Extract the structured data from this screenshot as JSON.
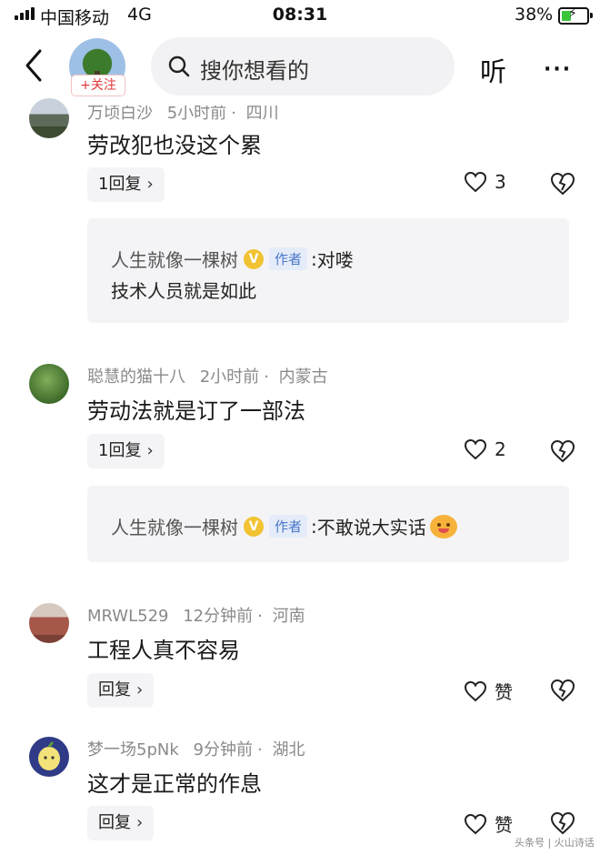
{
  "status_bar": {
    "carrier": "中国移动",
    "network": "4G",
    "time": "08:31",
    "battery": "38%",
    "battery_level": 0.38
  },
  "header": {
    "follow_label": "+关注",
    "search_placeholder": "搜你想看的",
    "listen_label": "听",
    "more_label": "···"
  },
  "comments": [
    {
      "author": "万顷白沙",
      "time": "5小时前",
      "location": "四川",
      "text": "劳改犯也没这个累",
      "reply_label": "1回复",
      "likes": "3",
      "sub_reply": {
        "author": "人生就像一棵树",
        "badge": "作者",
        "line1": "对喽",
        "line2": "技术人员就是如此"
      }
    },
    {
      "author": "聪慧的猫十八",
      "time": "2小时前",
      "location": "内蒙古",
      "text": "劳动法就是订了一部法",
      "reply_label": "1回复",
      "likes": "2",
      "sub_reply": {
        "author": "人生就像一棵树",
        "badge": "作者",
        "line1": "不敢说大实话"
      }
    },
    {
      "author": "MRWL529",
      "time": "12分钟前",
      "location": "河南",
      "text": "工程人真不容易",
      "reply_label": "回复",
      "likes": "赞"
    },
    {
      "author": "梦一场5pNk",
      "time": "9分钟前",
      "location": "湖北",
      "text": "这才是正常的作息",
      "reply_label": "回复",
      "likes": "赞"
    }
  ],
  "watermark": "头条号 | 火山诗话",
  "colors": {
    "follow_red": "#e2373b",
    "badge_gold": "#f1c232",
    "author_tag_blue": "#4b78c9"
  }
}
